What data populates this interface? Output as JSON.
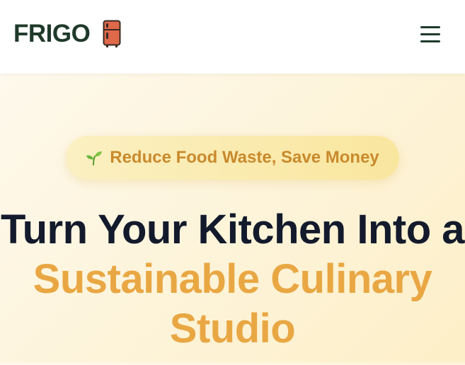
{
  "header": {
    "logo_text": "FRIGO",
    "logo_icon": "fridge-icon",
    "menu_icon": "hamburger-menu-icon"
  },
  "hero": {
    "badge": {
      "icon": "sprout-icon",
      "text": "Reduce Food Waste, Save Money"
    },
    "headline_line1": "Turn Your Kitchen Into a",
    "headline_line2": "Sustainable Culinary",
    "headline_line3": "Studio"
  },
  "colors": {
    "logo_text": "#1f3a2a",
    "fridge_body": "#e0694a",
    "badge_text": "#c98a2d",
    "headline_dark": "#131a2c",
    "headline_accent": "#e9a743",
    "sprout_green": "#6bb83a"
  }
}
